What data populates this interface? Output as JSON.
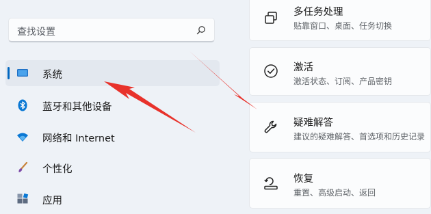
{
  "search": {
    "placeholder": "查找设置"
  },
  "sidebar": {
    "items": [
      {
        "label": "系统",
        "selected": true
      },
      {
        "label": "蓝牙和其他设备"
      },
      {
        "label": "网络和 Internet"
      },
      {
        "label": "个性化"
      },
      {
        "label": "应用"
      }
    ]
  },
  "main": {
    "cards": [
      {
        "title": "多任务处理",
        "subtitle": "贴靠窗口、桌面、任务切换",
        "icon": "multitasking-icon"
      },
      {
        "title": "激活",
        "subtitle": "激活状态、订阅、产品密钥",
        "icon": "activation-check-icon"
      },
      {
        "title": "疑难解答",
        "subtitle": "建议的疑难解答、首选项和历史记录",
        "icon": "wrench-icon"
      },
      {
        "title": "恢复",
        "subtitle": "重置、高级启动、返回",
        "icon": "recovery-icon"
      }
    ]
  },
  "colors": {
    "accent": "#0067c0",
    "arrow": "#e8322b",
    "bluetooth": "#0a78d4",
    "wifi": "#0a78d4"
  }
}
